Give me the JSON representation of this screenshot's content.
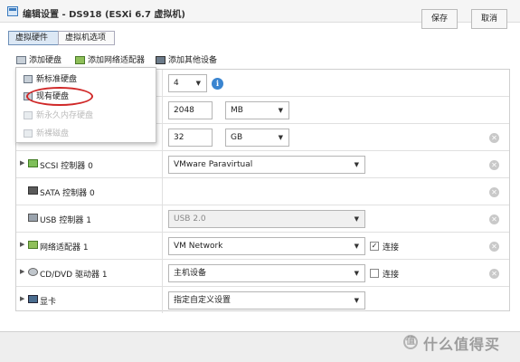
{
  "window": {
    "title": "编辑设置 - DS918 (ESXi 6.7 虚拟机)"
  },
  "tabs": [
    {
      "label": "虚拟硬件",
      "active": true
    },
    {
      "label": "虚拟机选项",
      "active": false
    }
  ],
  "toolbar": {
    "add_disk": "添加硬盘",
    "add_network": "添加网络适配器",
    "add_other": "添加其他设备"
  },
  "dropdown": {
    "items": [
      {
        "label": "新标准硬盘",
        "enabled": true
      },
      {
        "label": "现有硬盘",
        "enabled": true,
        "highlighted": true
      },
      {
        "label": "新永久内存硬盘",
        "enabled": false
      },
      {
        "label": "新裸磁盘",
        "enabled": false
      }
    ]
  },
  "rows": {
    "cpu": {
      "value": "4"
    },
    "memory": {
      "value": "2048",
      "unit": "MB"
    },
    "disk": {
      "value": "32",
      "unit": "GB"
    },
    "scsi": {
      "label": "SCSI 控制器 0",
      "value": "VMware Paravirtual"
    },
    "sata": {
      "label": "SATA 控制器 0"
    },
    "usb": {
      "label": "USB 控制器 1",
      "value": "USB 2.0"
    },
    "net": {
      "label": "网络适配器 1",
      "value": "VM Network",
      "connect_label": "连接",
      "connected": true
    },
    "cdrom": {
      "label": "CD/DVD 驱动器 1",
      "value": "主机设备",
      "connect_label": "连接",
      "connected": false
    },
    "video": {
      "label": "显卡",
      "value": "指定自定义设置"
    }
  },
  "footer": {
    "save": "保存",
    "cancel": "取消"
  },
  "watermark": {
    "text": "什么值得买",
    "logo": "值"
  },
  "colors": {
    "accent": "#3a85d0",
    "highlight_ring": "#d02828"
  }
}
